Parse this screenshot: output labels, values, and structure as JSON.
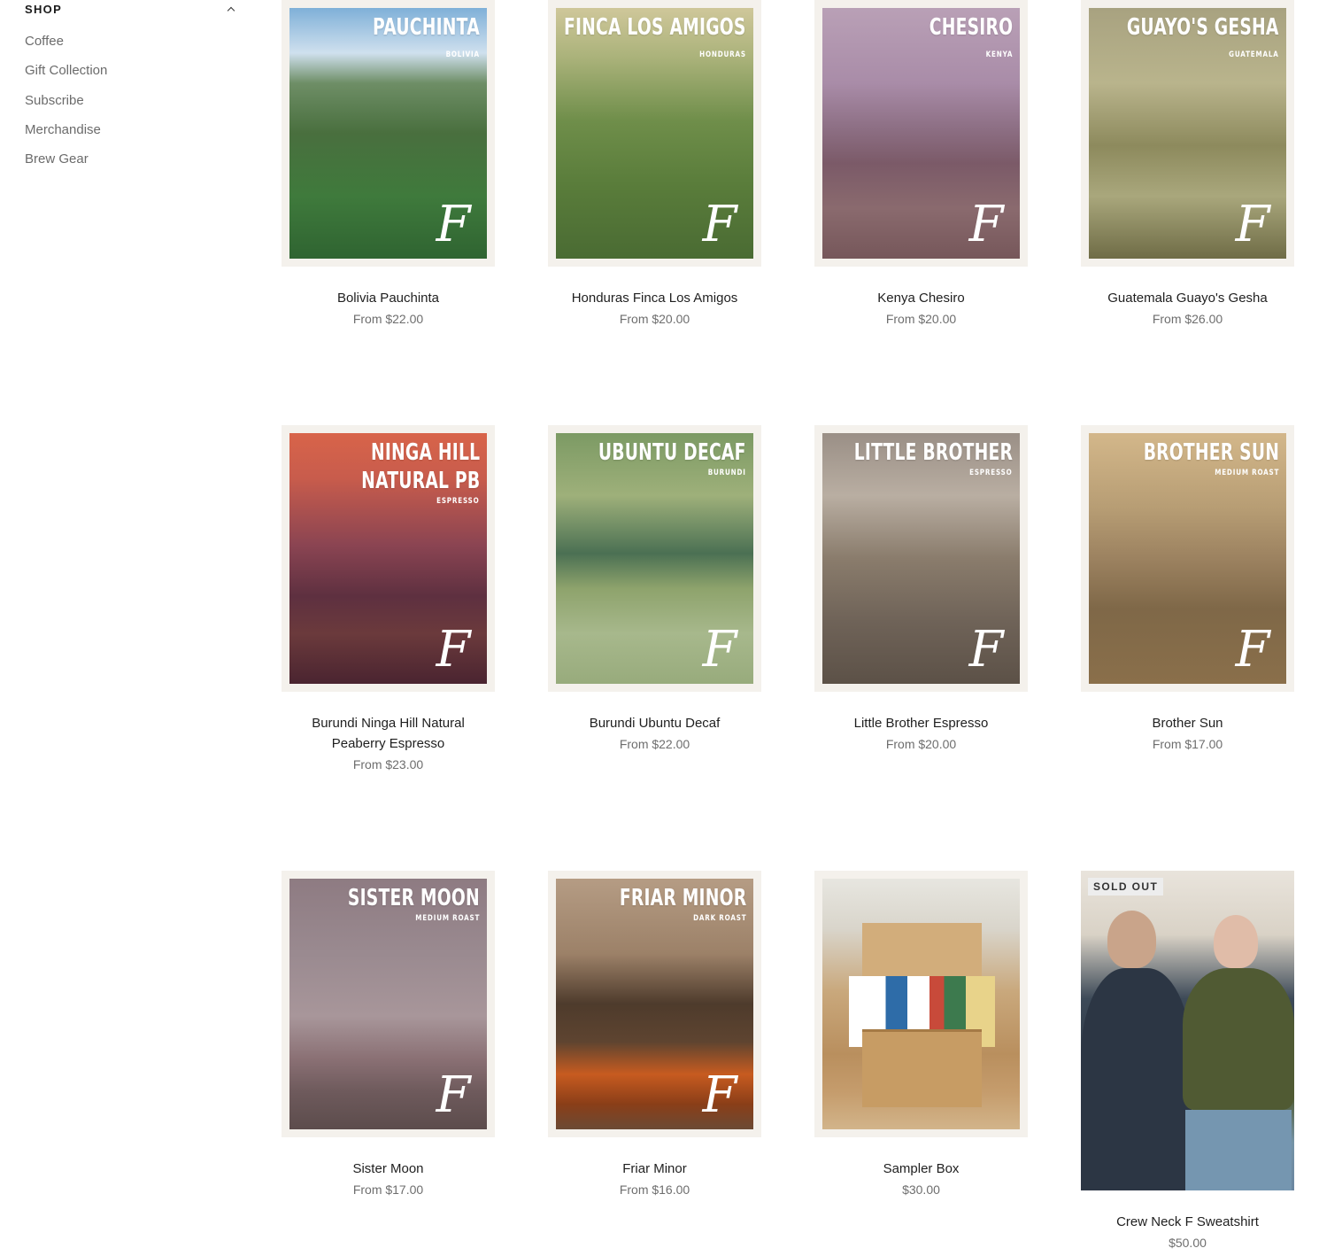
{
  "sidebar": {
    "title": "SHOP",
    "items": [
      "Coffee",
      "Gift Collection",
      "Subscribe",
      "Merchandise",
      "Brew Gear"
    ]
  },
  "products": [
    {
      "name": "Bolivia Pauchinta",
      "price": "From $22.00",
      "poster_title": "PAUCHINTA",
      "poster_sub": "BOLIVIA"
    },
    {
      "name": "Honduras Finca Los Amigos",
      "price": "From $20.00",
      "poster_title": "FINCA LOS AMIGOS",
      "poster_sub": "HONDURAS"
    },
    {
      "name": "Kenya Chesiro",
      "price": "From $20.00",
      "poster_title": "CHESIRO",
      "poster_sub": "KENYA"
    },
    {
      "name": "Guatemala Guayo's Gesha",
      "price": "From $26.00",
      "poster_title": "GUAYO'S GESHA",
      "poster_sub": "GUATEMALA"
    },
    {
      "name": "Burundi Ninga Hill Natural Peaberry Espresso",
      "price": "From $23.00",
      "poster_title_1": "NINGA HILL",
      "poster_title_2": "NATURAL PB",
      "poster_sub": "ESPRESSO"
    },
    {
      "name": "Burundi Ubuntu Decaf",
      "price": "From $22.00",
      "poster_title": "UBUNTU DECAF",
      "poster_sub": "BURUNDI"
    },
    {
      "name": "Little Brother Espresso",
      "price": "From $20.00",
      "poster_title": "LITTLE BROTHER",
      "poster_sub": "ESPRESSO"
    },
    {
      "name": "Brother Sun",
      "price": "From $17.00",
      "poster_title": "BROTHER SUN",
      "poster_sub": "MEDIUM ROAST"
    },
    {
      "name": "Sister Moon",
      "price": "From $17.00",
      "poster_title": "SISTER MOON",
      "poster_sub": "MEDIUM ROAST"
    },
    {
      "name": "Friar Minor",
      "price": "From $16.00",
      "poster_title": "FRIAR MINOR",
      "poster_sub": "DARK ROAST"
    },
    {
      "name": "Sampler Box",
      "price": "$30.00"
    },
    {
      "name": "Crew Neck F Sweatshirt",
      "price": "$50.00",
      "badge": "SOLD OUT"
    }
  ],
  "logo_glyph": "F",
  "icons": {
    "collapse": "chevron-up-icon",
    "brand": "f-logo-icon"
  }
}
